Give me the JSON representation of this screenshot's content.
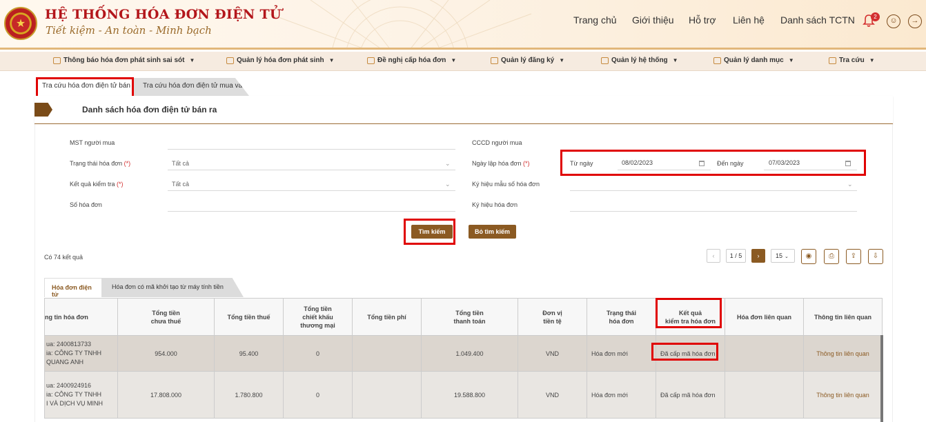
{
  "brand": {
    "title": "HỆ THỐNG HÓA ĐƠN ĐIỆN TỬ",
    "slogan": "Tiết kiệm - An toàn - Minh bạch"
  },
  "topnav": [
    "Trang chủ",
    "Giới thiệu",
    "Hỗ trợ",
    "Liên hệ",
    "Danh sách TCTN"
  ],
  "notifications": {
    "count": "2"
  },
  "mainnav": [
    "Thông báo hóa đơn phát sinh sai sót",
    "Quản lý hóa đơn phát sinh",
    "Đề nghị cấp hóa đơn",
    "Quản lý đăng ký",
    "Quản lý hệ thống",
    "Quản lý danh mục",
    "Tra cứu"
  ],
  "tabs": [
    "Tra cứu hóa đơn điện tử bán ra",
    "Tra cứu hóa đơn điện tử mua vào"
  ],
  "section_title": "Danh sách hóa đơn điện tử bán ra",
  "form": {
    "mst_label": "MST người mua",
    "cccd_label": "CCCD người mua",
    "status_label": "Trạng thái hóa đơn",
    "status_value": "Tất cả",
    "date_label": "Ngày lập hóa đơn",
    "from_label": "Từ ngày",
    "from_value": "08/02/2023",
    "to_label": "Đến ngày",
    "to_value": "07/03/2023",
    "check_label": "Kết quả kiểm tra",
    "check_value": "Tất cả",
    "template_label": "Ký hiệu mẫu số hóa đơn",
    "number_label": "Số hóa đơn",
    "symbol_label": "Ký hiệu hóa đơn",
    "required_mark": "(*)",
    "search_button": "Tìm kiếm",
    "clear_button": "Bỏ tìm kiếm"
  },
  "results": {
    "count_text": "Có 74 kết quả",
    "page": "1 / 5",
    "page_size": "15"
  },
  "subtabs": [
    "Hóa đơn điện tử",
    "Hóa đơn có mã khởi tạo từ máy tính tiền"
  ],
  "table": {
    "headers": [
      "ng tin hóa đơn",
      "Tổng tiền\nchưa thuế",
      "Tổng tiền thuế",
      "Tổng tiền\nchiết khấu\nthương mại",
      "Tổng tiền phí",
      "Tổng tiền\nthanh toán",
      "Đơn vị\ntiền tệ",
      "Trạng thái\nhóa đơn",
      "Kết quả\nkiểm tra hóa đơn",
      "Hóa đơn liên quan",
      "Thông tin liên quan"
    ],
    "rows": [
      {
        "info": [
          "ua: 2400813733",
          "ia: CÔNG TY TNHH",
          "QUANG ANH"
        ],
        "pre_tax": "954.000",
        "tax": "95.400",
        "discount": "0",
        "fee": "",
        "total": "1.049.400",
        "currency": "VND",
        "status": "Hóa đơn mới",
        "check": "Đã cấp mã hóa đơn",
        "related": "",
        "info_link": "Thông tin liên quan"
      },
      {
        "info": [
          "ua: 2400924916",
          "ia: CÔNG TY TNHH",
          "I VÀ DỊCH VỤ MINH"
        ],
        "pre_tax": "17.808.000",
        "tax": "1.780.800",
        "discount": "0",
        "fee": "",
        "total": "19.588.800",
        "currency": "VND",
        "status": "Hóa đơn mới",
        "check": "Đã cấp mã hóa đơn",
        "related": "",
        "info_link": "Thông tin liên quan"
      }
    ]
  },
  "colors": {
    "accent": "#8b5a22",
    "brand_red": "#b3161b",
    "highlight": "#e00000"
  }
}
